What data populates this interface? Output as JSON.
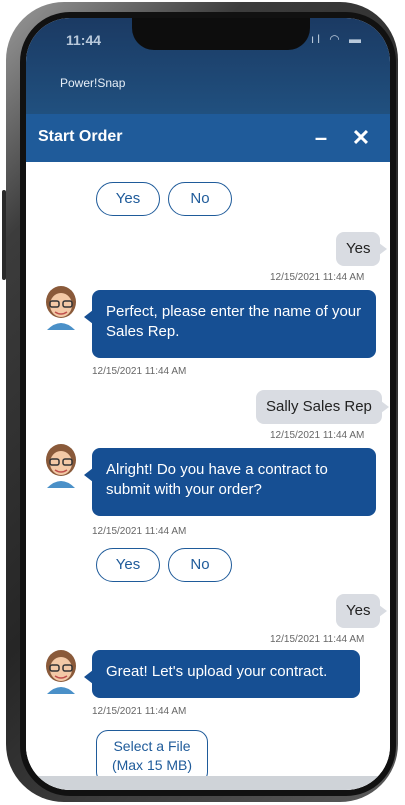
{
  "status_bar": {
    "time": "11:44",
    "icons": "ıl ◠ ▬"
  },
  "app": {
    "name": "Power!Snap"
  },
  "header": {
    "title": "Start Order",
    "minimize_label": "–",
    "close_label": "✕"
  },
  "chat": {
    "choice_yes": "Yes",
    "choice_no": "No",
    "messages": [
      {
        "from": "user",
        "text": "Yes",
        "time": "12/15/2021 11:44 AM"
      },
      {
        "from": "bot",
        "text": "Perfect, please enter the name of your Sales Rep.",
        "time": "12/15/2021 11:44 AM"
      },
      {
        "from": "user",
        "text": "Sally Sales Rep",
        "time": "12/15/2021 11:44 AM"
      },
      {
        "from": "bot",
        "text": "Alright!  Do you have a contract to submit with your order?",
        "time": "12/15/2021 11:44 AM"
      },
      {
        "from": "user",
        "text": "Yes",
        "time": "12/15/2021 11:44 AM"
      },
      {
        "from": "bot",
        "text": "Great! Let's upload your contract.",
        "time": "12/15/2021 11:44 AM"
      }
    ],
    "file_button": {
      "line1": "Select a File",
      "line2": "(Max 15 MB)"
    }
  },
  "colors": {
    "brand_blue": "#1f5b9a",
    "bot_bubble": "#164f93",
    "user_bubble": "#d9dce2"
  }
}
